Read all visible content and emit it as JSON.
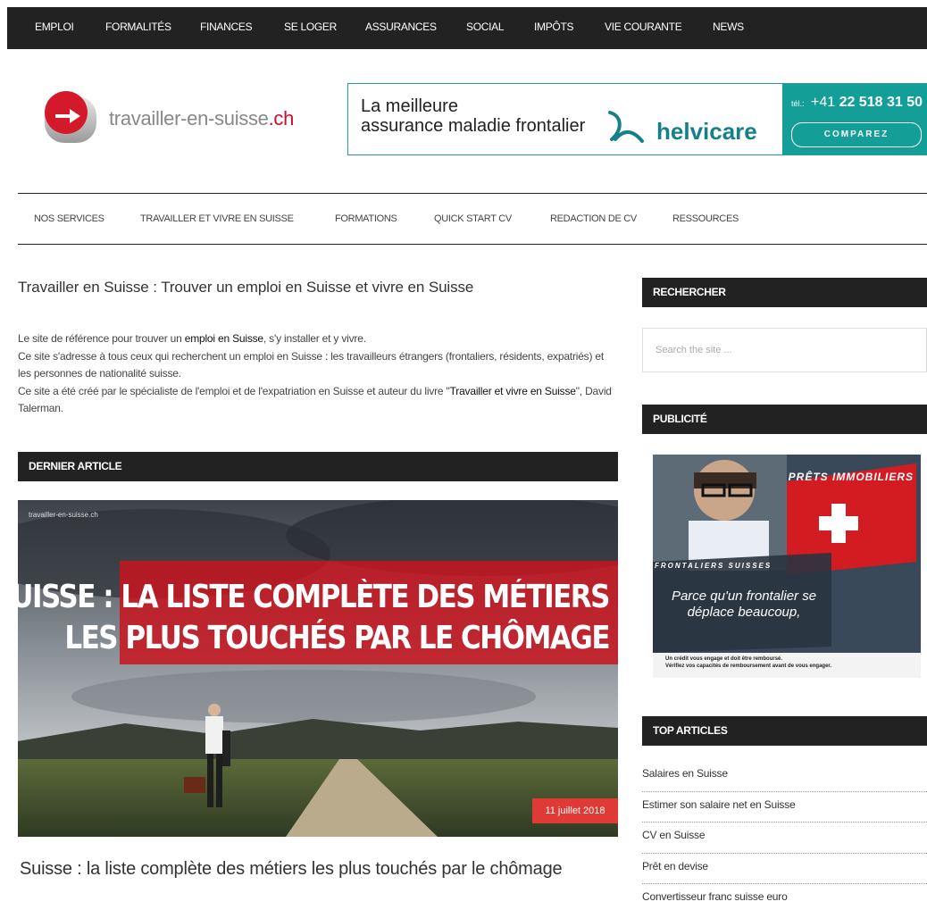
{
  "topnav": {
    "items": [
      "EMPLOI",
      "FORMALITÉS",
      "FINANCES",
      "SE LOGER",
      "ASSURANCES",
      "SOCIAL",
      "IMPÔTS",
      "VIE COURANTE",
      "NEWS"
    ]
  },
  "header": {
    "logo_text": "travailler-en-suisse",
    "logo_tld": ".ch",
    "banner": {
      "line1": "La meilleure",
      "line2": "assurance maladie frontalier",
      "brand": "helvicare",
      "phone_prefix": "tél.:",
      "phone_code": "+41",
      "phone_number": "22 518 31 50",
      "cta": "COMPAREZ"
    }
  },
  "subnav": {
    "items": [
      "NOS SERVICES",
      "TRAVAILLER ET VIVRE EN SUISSE",
      "FORMATIONS",
      "QUICK START CV",
      "REDACTION DE CV",
      "RESSOURCES"
    ]
  },
  "main": {
    "title": "Travailler en Suisse : Trouver un emploi en Suisse et vivre en Suisse",
    "intro": {
      "p1_before": "Le site de référence pour trouver un ",
      "p1_bold": "emploi en Suisse",
      "p1_after": ", s'y installer et y vivre.",
      "p2": "Ce site s'adresse à tous ceux qui recherchent un emploi en Suisse : les travailleurs étrangers (frontaliers, résidents, expatriés) et les personnes de nationalité suisse.",
      "p3_before": "Ce site a été créé par le spécialiste de l'emploi et de l'expatriation en Suisse et auteur du livre \"",
      "p3_bold": "Travailler et vivre en Suisse",
      "p3_after": "\", David Talerman."
    },
    "latest_heading": "DERNIER ARTICLE",
    "article": {
      "image_logo": "travailler-en-suisse.ch",
      "image_line1": "SUISSE : LA LISTE COMPLÈTE DES MÉTIERS",
      "image_line2": "LES PLUS TOUCHÉS PAR LE CHÔMAGE",
      "date": "11 juillet 2018",
      "title": "Suisse : la liste complète des métiers les plus touchés par le chômage"
    }
  },
  "sidebar": {
    "search_heading": "RECHERCHER",
    "search_placeholder": "Search the site ...",
    "ad_heading": "PUBLICITÉ",
    "ad": {
      "headline": "PRÊTS IMMOBILIERS",
      "subline": "FRONTALIERS SUISSES",
      "text": "Parce qu'un frontalier se déplace beaucoup,",
      "legal1": "Un crédit vous engage et doit être remboursé.",
      "legal2": "Vérifiez vos capacités de remboursement avant de vous engager."
    },
    "top_heading": "TOP ARTICLES",
    "top_articles": [
      "Salaires en Suisse",
      "Estimer son salaire net en Suisse",
      "CV en Suisse",
      "Prêt en devise",
      "Convertisseur franc suisse euro"
    ]
  },
  "colors": {
    "nav_bg": "#222222",
    "accent_red": "#c8102e",
    "teal": "#149e98",
    "date_badge": "#e03a36"
  }
}
